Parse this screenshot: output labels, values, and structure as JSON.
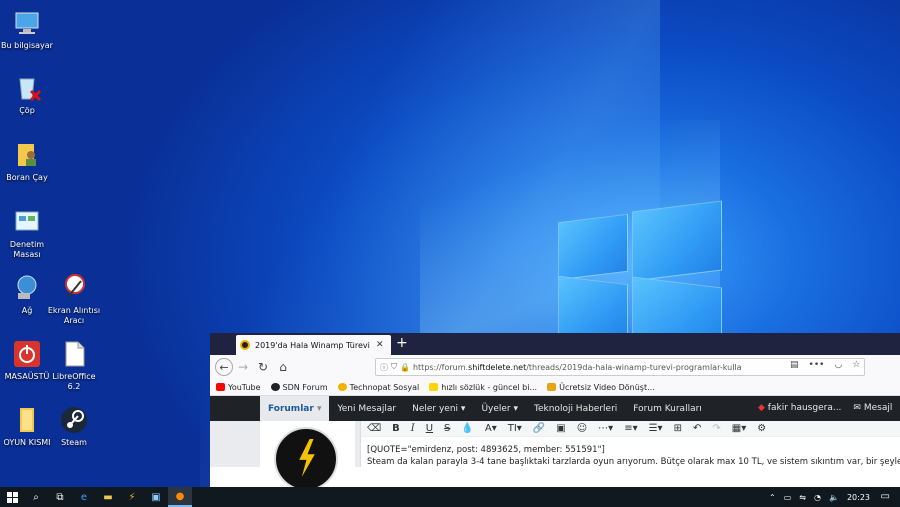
{
  "desktop": {
    "icons": [
      {
        "label": "Bu bilgisayar",
        "icon": "computer-icon"
      },
      {
        "label": "Çöp",
        "icon": "recycle-bin-icon"
      },
      {
        "label": "Boran Çay",
        "icon": "user-folder-icon"
      },
      {
        "label": "Denetim Masası",
        "icon": "control-panel-icon"
      },
      {
        "label": "Ağ",
        "icon": "network-icon"
      },
      {
        "label": "Ekran Alıntısı Aracı",
        "icon": "snipping-tool-icon"
      },
      {
        "label": "MASAÜSTÜ",
        "icon": "power-app-icon"
      },
      {
        "label": "LibreOffice 6.2",
        "icon": "document-icon"
      },
      {
        "label": "OYUN KISMI",
        "icon": "folder-icon"
      },
      {
        "label": "Steam",
        "icon": "steam-icon"
      }
    ]
  },
  "browser": {
    "tab_title": "2019'da Hala Winamp Türevi Pr",
    "url_prefix": "https://forum.",
    "url_domain": "shiftdelete.net",
    "url_path": "/threads/2019da-hala-winamp-turevi-programlar-kulla",
    "bookmarks": [
      "YouTube",
      "SDN Forum",
      "Technopat Sosyal",
      "hızlı sözlük - güncel bi...",
      "Ücretsiz Video Dönüşt..."
    ]
  },
  "site": {
    "nav_active": "Forumlar",
    "nav_items": [
      "Yeni Mesajlar",
      "Neler yeni ▾",
      "Üyeler ▾",
      "Teknoloji Haberleri",
      "Forum Kuralları"
    ],
    "user": "fakir hausgera...",
    "messages": "Mesajl"
  },
  "editor": {
    "line1": "[QUOTE=\"emirdenz, post: 4893625, member: 551591\"]",
    "line2": "Steam da kalan parayla 3-4 tane başlıktaki tarzlarda oyun arıyorum. Bütçe olarak max 10 TL, ve sistem sıkıntım var, bir şeyle"
  },
  "taskbar": {
    "clock": "20:23"
  },
  "colors": {
    "site_nav_bg": "#1f2327",
    "accent": "#185a9c",
    "tab_bar_bg": "#202340"
  }
}
